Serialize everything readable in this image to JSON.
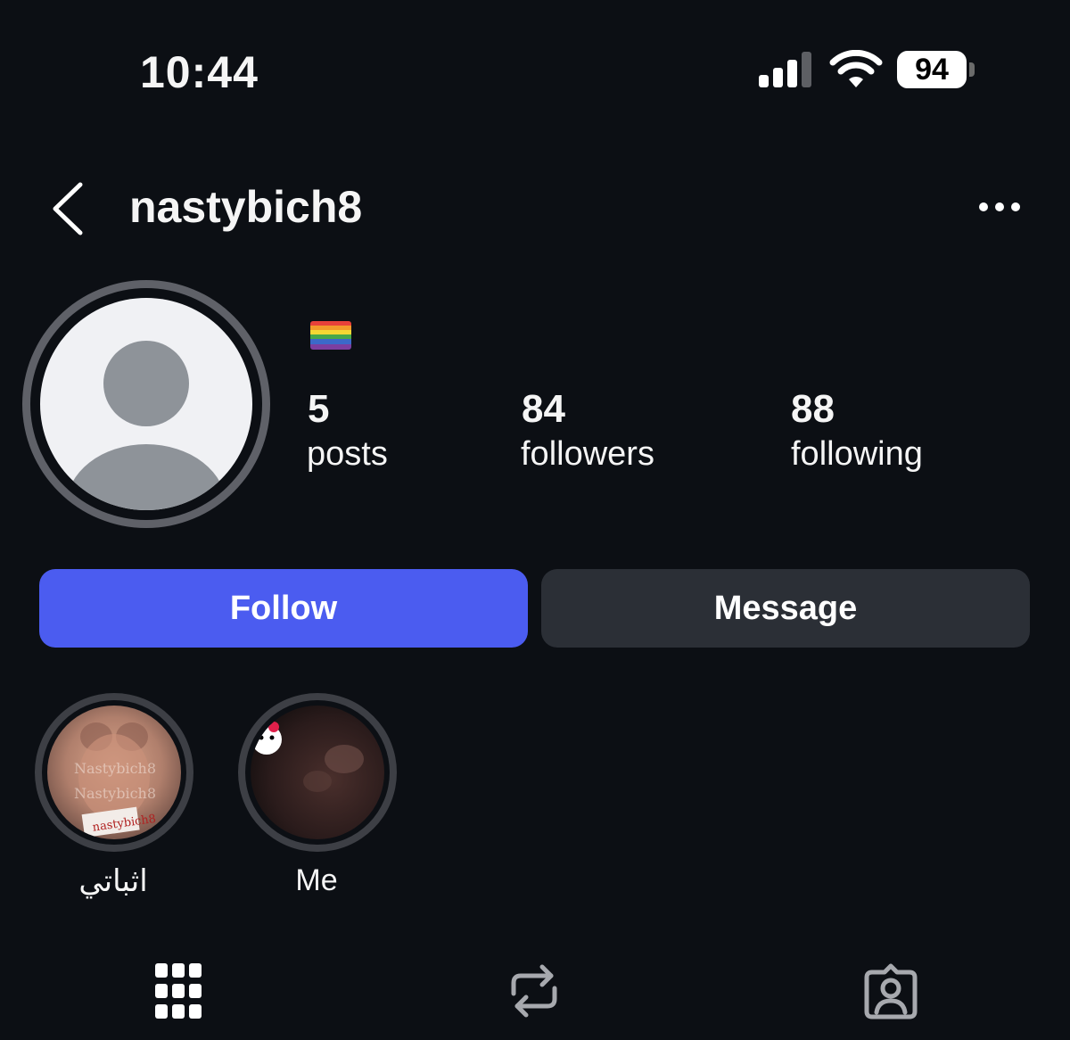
{
  "status_bar": {
    "time": "10:44",
    "battery": "94",
    "icons": [
      "cellular-signal-icon",
      "wifi-icon",
      "battery-icon"
    ]
  },
  "header": {
    "username": "nastybich8",
    "back_icon": "chevron-left-icon",
    "more_icon": "more-horizontal-icon"
  },
  "profile": {
    "avatar_icon": "default-avatar-icon",
    "bio": "🏳️‍🌈",
    "stats": [
      {
        "value": "5",
        "label": "posts"
      },
      {
        "value": "84",
        "label": "followers"
      },
      {
        "value": "88",
        "label": "following"
      }
    ]
  },
  "actions": {
    "follow_label": "Follow",
    "message_label": "Message",
    "follow_color": "#4b5cf0",
    "message_color": "#2b2f36"
  },
  "highlights": [
    {
      "label": "اثباتي"
    },
    {
      "label": "Me"
    }
  ],
  "tabs": [
    {
      "icon": "grid-icon"
    },
    {
      "icon": "reposts-icon"
    },
    {
      "icon": "tagged-icon"
    }
  ]
}
